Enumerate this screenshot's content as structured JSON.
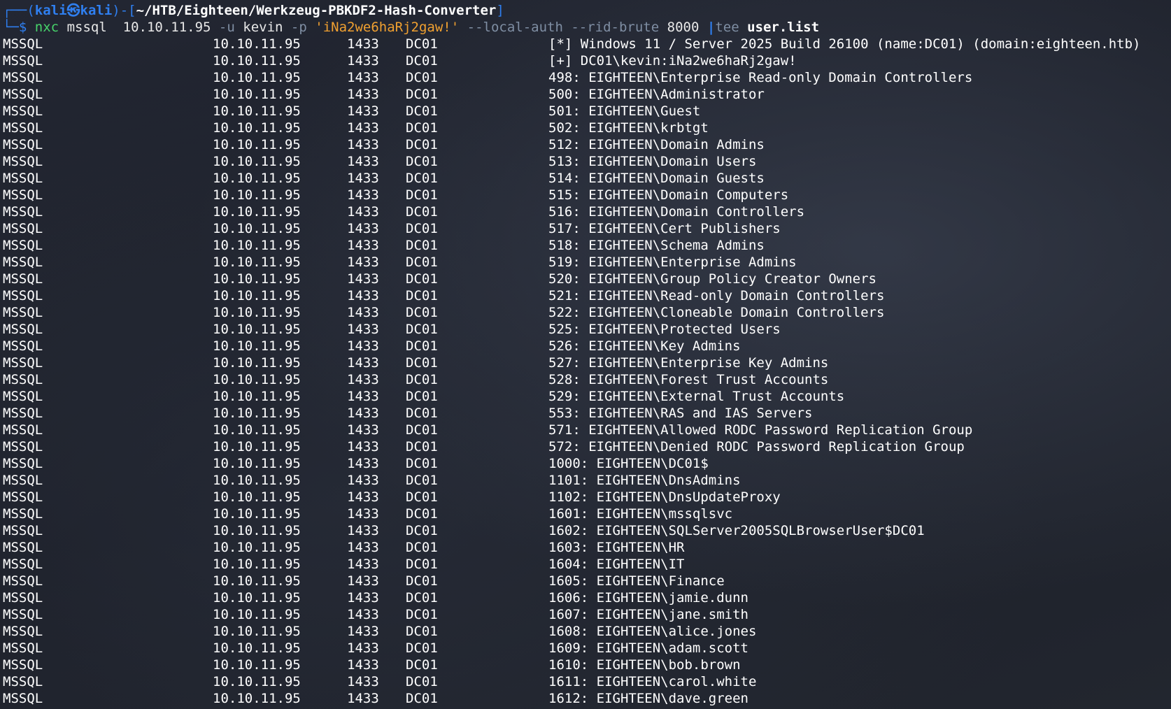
{
  "prompt": {
    "corner_top": "┌──(",
    "user": "kali㉿kali",
    "mid": ")-[",
    "path": "~/HTB/Eighteen/Werkzeug-PBKDF2-Hash-Converter",
    "end": "]",
    "corner_bottom": "└─$",
    "cmd": "nxc",
    "cmd_arg1": "mssql  10.10.11.95",
    "flag_u": "-u",
    "val_u": "kevin",
    "flag_p": "-p",
    "val_p": "'iNa2we6haRj2gaw!'",
    "flag_auth": "--local-auth",
    "flag_rid": "--rid-brute",
    "val_rid": "8000",
    "pipe": "|",
    "tee": "tee",
    "tee_file": "user.list"
  },
  "output": {
    "rows": [
      {
        "proto": "MSSQL",
        "ip": "10.10.11.95",
        "port": "1433",
        "host": "DC01",
        "msg": "[*] Windows 11 / Server 2025 Build 26100 (name:DC01) (domain:eighteen.htb)"
      },
      {
        "proto": "MSSQL",
        "ip": "10.10.11.95",
        "port": "1433",
        "host": "DC01",
        "msg": "[+] DC01\\kevin:iNa2we6haRj2gaw!"
      },
      {
        "proto": "MSSQL",
        "ip": "10.10.11.95",
        "port": "1433",
        "host": "DC01",
        "msg": "498: EIGHTEEN\\Enterprise Read-only Domain Controllers"
      },
      {
        "proto": "MSSQL",
        "ip": "10.10.11.95",
        "port": "1433",
        "host": "DC01",
        "msg": "500: EIGHTEEN\\Administrator"
      },
      {
        "proto": "MSSQL",
        "ip": "10.10.11.95",
        "port": "1433",
        "host": "DC01",
        "msg": "501: EIGHTEEN\\Guest"
      },
      {
        "proto": "MSSQL",
        "ip": "10.10.11.95",
        "port": "1433",
        "host": "DC01",
        "msg": "502: EIGHTEEN\\krbtgt"
      },
      {
        "proto": "MSSQL",
        "ip": "10.10.11.95",
        "port": "1433",
        "host": "DC01",
        "msg": "512: EIGHTEEN\\Domain Admins"
      },
      {
        "proto": "MSSQL",
        "ip": "10.10.11.95",
        "port": "1433",
        "host": "DC01",
        "msg": "513: EIGHTEEN\\Domain Users"
      },
      {
        "proto": "MSSQL",
        "ip": "10.10.11.95",
        "port": "1433",
        "host": "DC01",
        "msg": "514: EIGHTEEN\\Domain Guests"
      },
      {
        "proto": "MSSQL",
        "ip": "10.10.11.95",
        "port": "1433",
        "host": "DC01",
        "msg": "515: EIGHTEEN\\Domain Computers"
      },
      {
        "proto": "MSSQL",
        "ip": "10.10.11.95",
        "port": "1433",
        "host": "DC01",
        "msg": "516: EIGHTEEN\\Domain Controllers"
      },
      {
        "proto": "MSSQL",
        "ip": "10.10.11.95",
        "port": "1433",
        "host": "DC01",
        "msg": "517: EIGHTEEN\\Cert Publishers"
      },
      {
        "proto": "MSSQL",
        "ip": "10.10.11.95",
        "port": "1433",
        "host": "DC01",
        "msg": "518: EIGHTEEN\\Schema Admins"
      },
      {
        "proto": "MSSQL",
        "ip": "10.10.11.95",
        "port": "1433",
        "host": "DC01",
        "msg": "519: EIGHTEEN\\Enterprise Admins"
      },
      {
        "proto": "MSSQL",
        "ip": "10.10.11.95",
        "port": "1433",
        "host": "DC01",
        "msg": "520: EIGHTEEN\\Group Policy Creator Owners"
      },
      {
        "proto": "MSSQL",
        "ip": "10.10.11.95",
        "port": "1433",
        "host": "DC01",
        "msg": "521: EIGHTEEN\\Read-only Domain Controllers"
      },
      {
        "proto": "MSSQL",
        "ip": "10.10.11.95",
        "port": "1433",
        "host": "DC01",
        "msg": "522: EIGHTEEN\\Cloneable Domain Controllers"
      },
      {
        "proto": "MSSQL",
        "ip": "10.10.11.95",
        "port": "1433",
        "host": "DC01",
        "msg": "525: EIGHTEEN\\Protected Users"
      },
      {
        "proto": "MSSQL",
        "ip": "10.10.11.95",
        "port": "1433",
        "host": "DC01",
        "msg": "526: EIGHTEEN\\Key Admins"
      },
      {
        "proto": "MSSQL",
        "ip": "10.10.11.95",
        "port": "1433",
        "host": "DC01",
        "msg": "527: EIGHTEEN\\Enterprise Key Admins"
      },
      {
        "proto": "MSSQL",
        "ip": "10.10.11.95",
        "port": "1433",
        "host": "DC01",
        "msg": "528: EIGHTEEN\\Forest Trust Accounts"
      },
      {
        "proto": "MSSQL",
        "ip": "10.10.11.95",
        "port": "1433",
        "host": "DC01",
        "msg": "529: EIGHTEEN\\External Trust Accounts"
      },
      {
        "proto": "MSSQL",
        "ip": "10.10.11.95",
        "port": "1433",
        "host": "DC01",
        "msg": "553: EIGHTEEN\\RAS and IAS Servers"
      },
      {
        "proto": "MSSQL",
        "ip": "10.10.11.95",
        "port": "1433",
        "host": "DC01",
        "msg": "571: EIGHTEEN\\Allowed RODC Password Replication Group"
      },
      {
        "proto": "MSSQL",
        "ip": "10.10.11.95",
        "port": "1433",
        "host": "DC01",
        "msg": "572: EIGHTEEN\\Denied RODC Password Replication Group"
      },
      {
        "proto": "MSSQL",
        "ip": "10.10.11.95",
        "port": "1433",
        "host": "DC01",
        "msg": "1000: EIGHTEEN\\DC01$"
      },
      {
        "proto": "MSSQL",
        "ip": "10.10.11.95",
        "port": "1433",
        "host": "DC01",
        "msg": "1101: EIGHTEEN\\DnsAdmins"
      },
      {
        "proto": "MSSQL",
        "ip": "10.10.11.95",
        "port": "1433",
        "host": "DC01",
        "msg": "1102: EIGHTEEN\\DnsUpdateProxy"
      },
      {
        "proto": "MSSQL",
        "ip": "10.10.11.95",
        "port": "1433",
        "host": "DC01",
        "msg": "1601: EIGHTEEN\\mssqlsvc"
      },
      {
        "proto": "MSSQL",
        "ip": "10.10.11.95",
        "port": "1433",
        "host": "DC01",
        "msg": "1602: EIGHTEEN\\SQLServer2005SQLBrowserUser$DC01"
      },
      {
        "proto": "MSSQL",
        "ip": "10.10.11.95",
        "port": "1433",
        "host": "DC01",
        "msg": "1603: EIGHTEEN\\HR"
      },
      {
        "proto": "MSSQL",
        "ip": "10.10.11.95",
        "port": "1433",
        "host": "DC01",
        "msg": "1604: EIGHTEEN\\IT"
      },
      {
        "proto": "MSSQL",
        "ip": "10.10.11.95",
        "port": "1433",
        "host": "DC01",
        "msg": "1605: EIGHTEEN\\Finance"
      },
      {
        "proto": "MSSQL",
        "ip": "10.10.11.95",
        "port": "1433",
        "host": "DC01",
        "msg": "1606: EIGHTEEN\\jamie.dunn"
      },
      {
        "proto": "MSSQL",
        "ip": "10.10.11.95",
        "port": "1433",
        "host": "DC01",
        "msg": "1607: EIGHTEEN\\jane.smith"
      },
      {
        "proto": "MSSQL",
        "ip": "10.10.11.95",
        "port": "1433",
        "host": "DC01",
        "msg": "1608: EIGHTEEN\\alice.jones"
      },
      {
        "proto": "MSSQL",
        "ip": "10.10.11.95",
        "port": "1433",
        "host": "DC01",
        "msg": "1609: EIGHTEEN\\adam.scott"
      },
      {
        "proto": "MSSQL",
        "ip": "10.10.11.95",
        "port": "1433",
        "host": "DC01",
        "msg": "1610: EIGHTEEN\\bob.brown"
      },
      {
        "proto": "MSSQL",
        "ip": "10.10.11.95",
        "port": "1433",
        "host": "DC01",
        "msg": "1611: EIGHTEEN\\carol.white"
      },
      {
        "proto": "MSSQL",
        "ip": "10.10.11.95",
        "port": "1433",
        "host": "DC01",
        "msg": "1612: EIGHTEEN\\dave.green"
      }
    ]
  },
  "colors": {
    "background": "#1a1d26",
    "prompt_blue": "#2f7ff0",
    "command_green": "#47d36b",
    "string_orange": "#f0a030",
    "flag_gray": "#7f8ea3",
    "text_white": "#ffffff"
  }
}
